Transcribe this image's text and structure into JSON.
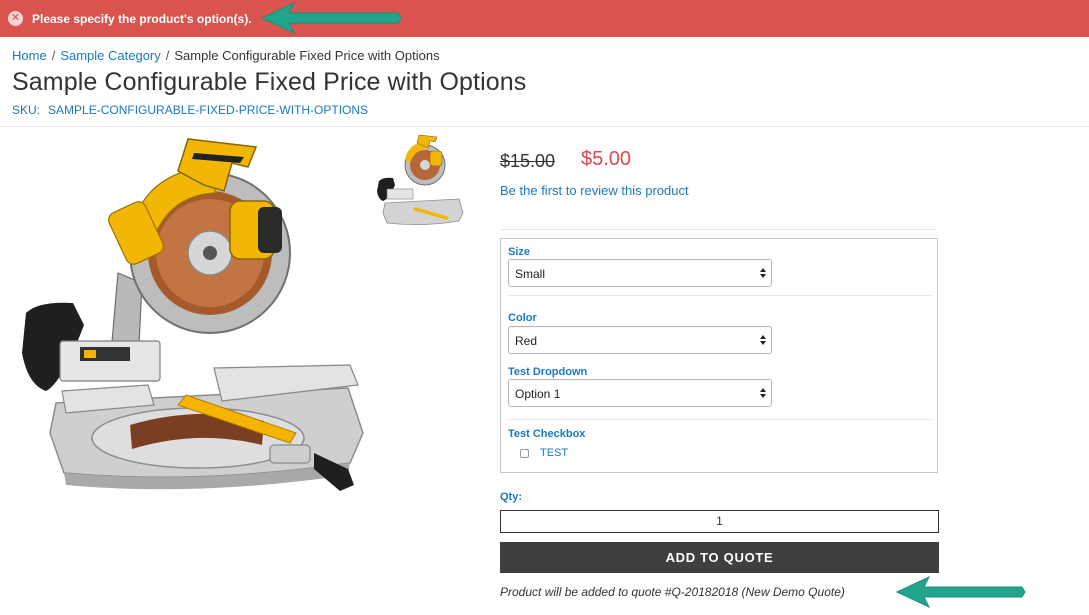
{
  "notice": {
    "message": "Please specify the product's option(s).",
    "icon": "close-circle-icon",
    "color": "#d9534f"
  },
  "breadcrumb": [
    {
      "label": "Home"
    },
    {
      "label": "Sample Category"
    },
    {
      "label": "Sample Configurable Fixed Price with Options"
    }
  ],
  "breadcrumb_separator": "/",
  "product": {
    "title": "Sample Configurable Fixed Price with Options",
    "sku_label": "SKU:",
    "sku_value": "SAMPLE-CONFIGURABLE-FIXED-PRICE-WITH-OPTIONS",
    "image": "miter-saw-image",
    "thumbnail": "miter-saw-thumbnail",
    "old_price": "$15.00",
    "price": "$5.00",
    "review_link": "Be the first to review this product"
  },
  "options": {
    "size": {
      "label": "Size",
      "selected": "Small"
    },
    "color": {
      "label": "Color",
      "selected": "Red"
    },
    "test_dropdown": {
      "label": "Test Dropdown",
      "selected": "Option 1"
    },
    "test_checkbox": {
      "label": "Test Checkbox",
      "option_label": "TEST",
      "checked": false
    }
  },
  "qty": {
    "label": "Qty:",
    "value": "1"
  },
  "add_button": {
    "label": "ADD TO QUOTE"
  },
  "quote_note": "Product will be added to quote #Q-20182018 (New Demo Quote)",
  "annotation": {
    "arrow_color": "#20a58c"
  },
  "colors": {
    "link": "#1979c3",
    "special_price": "#e0484c",
    "button": "#3f3f3f"
  }
}
